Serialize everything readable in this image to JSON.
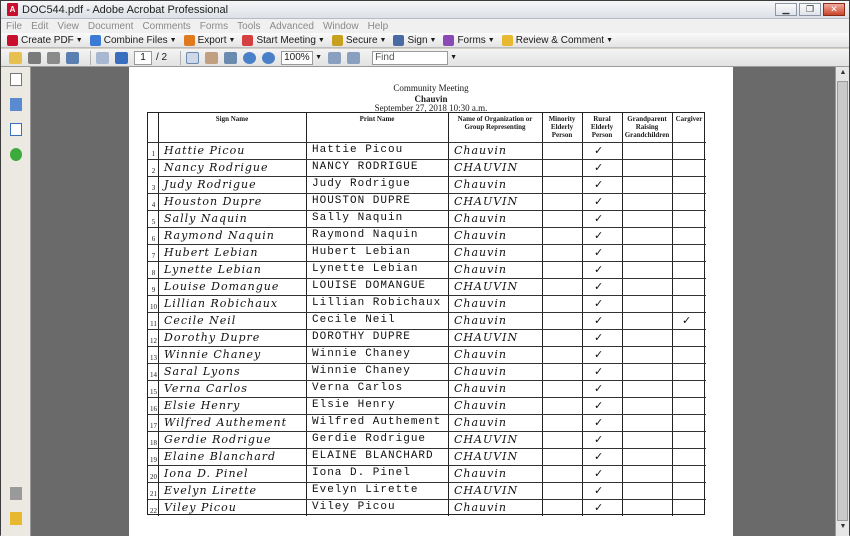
{
  "window": {
    "title": "DOC544.pdf - Adobe Acrobat Professional"
  },
  "menu": [
    "File",
    "Edit",
    "View",
    "Document",
    "Comments",
    "Forms",
    "Tools",
    "Advanced",
    "Window",
    "Help"
  ],
  "toolbar": {
    "create_pdf": "Create PDF",
    "combine_files": "Combine Files",
    "export": "Export",
    "start_meeting": "Start Meeting",
    "secure": "Secure",
    "sign": "Sign",
    "forms": "Forms",
    "review_comment": "Review & Comment"
  },
  "nav": {
    "current_page": "1",
    "total_pages": "/ 2",
    "zoom": "100%",
    "find_placeholder": "Find"
  },
  "document": {
    "title": "Community Meeting",
    "location": "Chauvin",
    "datetime": "September 27, 2018 10:30 a.m.",
    "columns": [
      "Sign Name",
      "Print Name",
      "Name of Organization or Group Representing",
      "Minority Elderly Person",
      "Rural Elderly Person",
      "Grandparent Raising Grandchildren",
      "Cargiver"
    ],
    "rows": [
      {
        "n": "1",
        "sign": "Hattie Picou",
        "print": "Hattie Picou",
        "org": "Chauvin",
        "rural": "✓",
        "care": ""
      },
      {
        "n": "2",
        "sign": "Nancy Rodrigue",
        "print": "NANCY RODRIGUE",
        "org": "CHAUVIN",
        "rural": "✓",
        "care": ""
      },
      {
        "n": "3",
        "sign": "Judy Rodrigue",
        "print": "Judy Rodrigue",
        "org": "Chauvin",
        "rural": "✓",
        "care": ""
      },
      {
        "n": "4",
        "sign": "Houston Dupre",
        "print": "HOUSTON DUPRE",
        "org": "CHAUVIN",
        "rural": "✓",
        "care": ""
      },
      {
        "n": "5",
        "sign": "Sally Naquin",
        "print": "Sally Naquin",
        "org": "Chauvin",
        "rural": "✓",
        "care": ""
      },
      {
        "n": "6",
        "sign": "Raymond Naquin",
        "print": "Raymond Naquin",
        "org": "Chauvin",
        "rural": "✓",
        "care": ""
      },
      {
        "n": "7",
        "sign": "Hubert Lebian",
        "print": "Hubert Lebian",
        "org": "Chauvin",
        "rural": "✓",
        "care": ""
      },
      {
        "n": "8",
        "sign": "Lynette Lebian",
        "print": "Lynette Lebian",
        "org": "Chauvin",
        "rural": "✓",
        "care": ""
      },
      {
        "n": "9",
        "sign": "Louise Domangue",
        "print": "LOUISE DOMANGUE",
        "org": "CHAUVIN",
        "rural": "✓",
        "care": ""
      },
      {
        "n": "10",
        "sign": "Lillian Robichaux",
        "print": "Lillian Robichaux",
        "org": "Chauvin",
        "rural": "✓",
        "care": ""
      },
      {
        "n": "11",
        "sign": "Cecile Neil",
        "print": "Cecile Neil",
        "org": "Chauvin",
        "rural": "✓",
        "care": "✓"
      },
      {
        "n": "12",
        "sign": "Dorothy Dupre",
        "print": "DOROTHY DUPRE",
        "org": "CHAUVIN",
        "rural": "✓",
        "care": ""
      },
      {
        "n": "13",
        "sign": "Winnie Chaney",
        "print": "Winnie Chaney",
        "org": "Chauvin",
        "rural": "✓",
        "care": ""
      },
      {
        "n": "14",
        "sign": "Saral Lyons",
        "print": "Winnie Chaney",
        "org": "Chauvin",
        "rural": "✓",
        "care": ""
      },
      {
        "n": "15",
        "sign": "Verna Carlos",
        "print": "Verna Carlos",
        "org": "Chauvin",
        "rural": "✓",
        "care": ""
      },
      {
        "n": "16",
        "sign": "Elsie Henry",
        "print": "Elsie Henry",
        "org": "Chauvin",
        "rural": "✓",
        "care": ""
      },
      {
        "n": "17",
        "sign": "Wilfred Authement",
        "print": "Wilfred Authement",
        "org": "Chauvin",
        "rural": "✓",
        "care": ""
      },
      {
        "n": "18",
        "sign": "Gerdie Rodrigue",
        "print": "Gerdie Rodrigue",
        "org": "CHAUVIN",
        "rural": "✓",
        "care": ""
      },
      {
        "n": "19",
        "sign": "Elaine Blanchard",
        "print": "ELAINE BLANCHARD",
        "org": "CHAUVIN",
        "rural": "✓",
        "care": ""
      },
      {
        "n": "20",
        "sign": "Iona D. Pinel",
        "print": "Iona D. Pinel",
        "org": "Chauvin",
        "rural": "✓",
        "care": ""
      },
      {
        "n": "21",
        "sign": "Evelyn Lirette",
        "print": "Evelyn Lirette",
        "org": "CHAUVIN",
        "rural": "✓",
        "care": ""
      },
      {
        "n": "22",
        "sign": "Viley Picou",
        "print": "Viley Picou",
        "org": "Chauvin",
        "rural": "✓",
        "care": ""
      }
    ]
  }
}
